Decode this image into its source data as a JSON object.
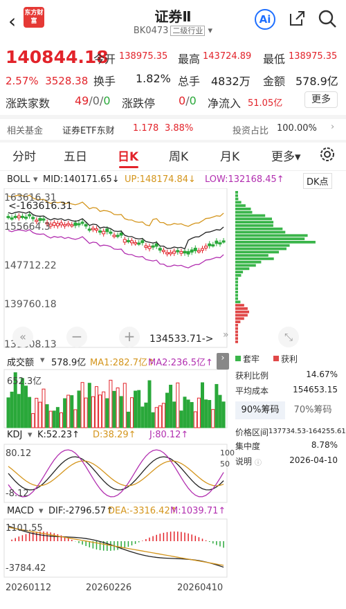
{
  "header": {
    "title": "证券Ⅱ",
    "code": "BK0473",
    "category": "二级行业",
    "logo": "东方财富",
    "ai": "Ai"
  },
  "quote": {
    "price": "140844.18",
    "pct": "2.57%",
    "chg": "3528.38",
    "open_label": "今开",
    "open": "138975.35",
    "high_label": "最高",
    "high": "143724.89",
    "low_label": "最低",
    "low": "138975.35",
    "turnover_label": "换手",
    "turnover": "1.82%",
    "vol_label": "总手",
    "vol": "4832万",
    "amount_label": "金额",
    "amount": "578.9亿",
    "updown_label": "涨跌家数",
    "up": "49",
    "flat": "0",
    "down": "0",
    "limit_label": "涨跌停",
    "limit_up": "0",
    "limit_down": "0",
    "inflow_label": "净流入",
    "inflow": "51.05亿",
    "more": "更多"
  },
  "fund": {
    "label": "相关基金",
    "name": "证券ETF东财",
    "price": "1.178",
    "pct": "3.88%",
    "ratio_label": "投资占比",
    "ratio": "100.00%"
  },
  "tabs": [
    "分时",
    "五日",
    "日K",
    "周K",
    "月K",
    "更多"
  ],
  "boll": {
    "name": "BOLL",
    "mid": "MID:140171.65↓",
    "up": "UP:148174.84↓",
    "low": "LOW:132168.45↑",
    "dk": "DK点"
  },
  "kaxis": {
    "max": "163616.31",
    "max_mark": "<-163616.31",
    "l2": "155664.3",
    "l3": "147712.22",
    "l4": "139760.18",
    "l5": "131808.13",
    "min_mark": "134533.71->"
  },
  "vol": {
    "name": "成交额",
    "val": "578.9亿",
    "ma1": "MA1:282.7亿↑",
    "ma2": "MA2:236.5亿↑",
    "axis": "652.3亿"
  },
  "kdj": {
    "name": "KDJ",
    "k": "K:52.23↑",
    "d": "D:38.29↑",
    "j": "J:80.12↑",
    "top": "80.12",
    "bot": "-8.12",
    "r1": "100",
    "r2": "50"
  },
  "macd": {
    "name": "MACD",
    "dif": "DIF:-2796.57↑",
    "dea": "DEA:-3316.42↑",
    "m": "M:1039.71↑",
    "top": "1101.55",
    "bot": "-3784.42"
  },
  "dates": [
    "20260112",
    "20260226",
    "20260410"
  ],
  "chips": {
    "legend1": "套牢",
    "legend2": "获利",
    "profit_label": "获利比例",
    "profit": "14.67%",
    "cost_label": "平均成本",
    "cost": "154653.15",
    "tab1": "90%筹码",
    "tab2": "70%筹码",
    "range_label": "价格区间",
    "range": "137734.53-164255.61",
    "conc_label": "集中度",
    "conc": "8.78%",
    "note_label": "说明",
    "date": "2026-04-10"
  },
  "chart_data": {
    "type": "candlestick",
    "note": "sector index daily K-line",
    "last": 140844.18,
    "high": 163616.31,
    "low": 134533.71
  }
}
